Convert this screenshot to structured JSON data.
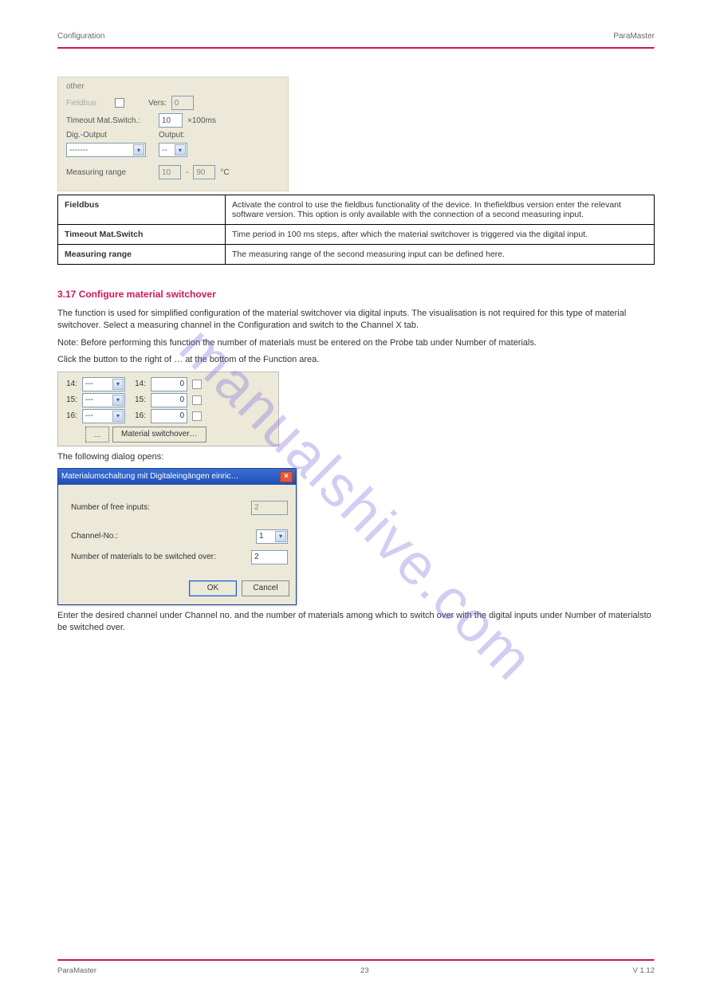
{
  "header": {
    "left": "Configuration",
    "right": "ParaMaster"
  },
  "panel_other": {
    "group": "other",
    "fieldbus_label": "Fieldbus",
    "vers_label": "Vers:",
    "vers_value": "0",
    "timeout_label": "Timeout Mat.Switch.:",
    "timeout_value": "10",
    "timeout_unit": "×100ms",
    "digout_label": "Dig.-Output",
    "output_label": "Output:",
    "digout_value": "-------",
    "output_value": "--",
    "measrange_label": "Measuring range",
    "measrange_from": "10",
    "measrange_sep": "-",
    "measrange_to": "90",
    "measrange_unit": "°C"
  },
  "table": {
    "rows": [
      {
        "k": "Fieldbus",
        "v": "Activate the control to use the fieldbus functionality of the device. In thefieldbus version enter the relevant software version. This option is only available with the connection of a second measuring input."
      },
      {
        "k": "Timeout Mat.Switch",
        "v": "Time period in 100 ms steps, after which the material switchover is triggered via the digital input."
      },
      {
        "k": "Measuring range",
        "v": "The measuring range of the second measuring input can be defined here."
      }
    ]
  },
  "section2": {
    "title": "3.17 Configure material switchover",
    "p1": "The function is used for simplified configuration of the material switchover via digital inputs. The visualisation is not required for this type of material switchover. Select a measuring channel in the Configuration and switch to the Channel X tab.",
    "p2": "Note: Before performing this function the number of materials must be entered on the Probe tab under Number of materials.",
    "p3": "Click the button to the right of … at the bottom of the Function area.",
    "p4": "The following dialog opens:",
    "p5": "Enter the desired channel under Channel no. and the number of materials among which to switch over with the digital inputs under Number of materialsto be switched over."
  },
  "matlist": {
    "rows": [
      {
        "n": "14:",
        "sel": "---",
        "v": "0"
      },
      {
        "n": "15:",
        "sel": "---",
        "v": "0"
      },
      {
        "n": "16:",
        "sel": "---",
        "v": "0"
      }
    ],
    "right_nums": [
      "14:",
      "15:",
      "16:"
    ],
    "dots_btn": "…",
    "switch_btn": "Material switchover…"
  },
  "dialog": {
    "title": "Materialumschaltung mit Digitaleingängen einric…",
    "free_inputs_label": "Number of free inputs:",
    "free_inputs_value": "2",
    "channel_label": "Channel-No.:",
    "channel_value": "1",
    "nummat_label": "Number of materials to be switched over:",
    "nummat_value": "2",
    "ok": "OK",
    "cancel": "Cancel"
  },
  "footer": {
    "left": "ParaMaster",
    "center": "23",
    "right": "V 1.12"
  },
  "watermark": "manualshive.com"
}
